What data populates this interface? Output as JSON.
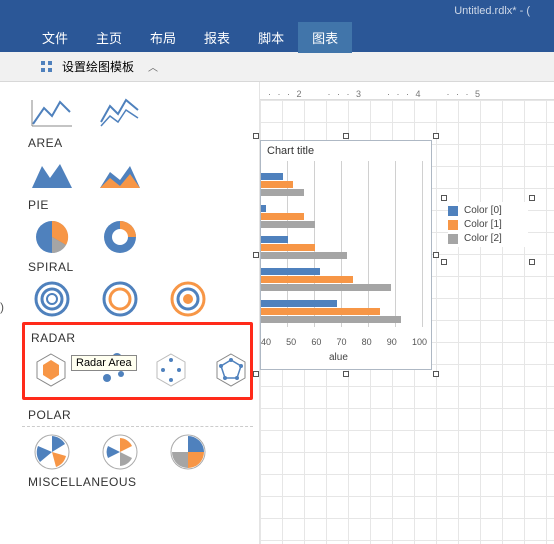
{
  "title": "Untitled.rdlx* - (",
  "menu": {
    "file": "文件",
    "home": "主页",
    "layout": "布局",
    "report": "报表",
    "script": "脚本",
    "chart": "图表"
  },
  "toolbar": {
    "template_label": "设置绘图模板"
  },
  "sections": {
    "area": "AREA",
    "pie": "PIE",
    "spiral": "SPIRAL",
    "radar": "RADAR",
    "polar": "POLAR",
    "misc": "MISCELLANEOUS"
  },
  "tooltip": "Radar Area",
  "ruler": [
    "2",
    "3",
    "4",
    "5"
  ],
  "chart_data": {
    "type": "bar",
    "orientation": "horizontal",
    "title": "Chart title",
    "xlabel": "alue",
    "xlim": [
      40,
      100
    ],
    "xticks": [
      40,
      50,
      60,
      70,
      80,
      90,
      100
    ],
    "legend": [
      "Color [0]",
      "Color [1]",
      "Color [2]"
    ],
    "colors": {
      "0": "#4f81bd",
      "1": "#f79646",
      "2": "#a5a5a5"
    },
    "series": [
      {
        "name": "Color [0]",
        "values": [
          48,
          42,
          50,
          62,
          68
        ]
      },
      {
        "name": "Color [1]",
        "values": [
          52,
          56,
          60,
          74,
          84
        ]
      },
      {
        "name": "Color [2]",
        "values": [
          56,
          60,
          72,
          88,
          92
        ]
      }
    ]
  },
  "left_fragment": ")"
}
